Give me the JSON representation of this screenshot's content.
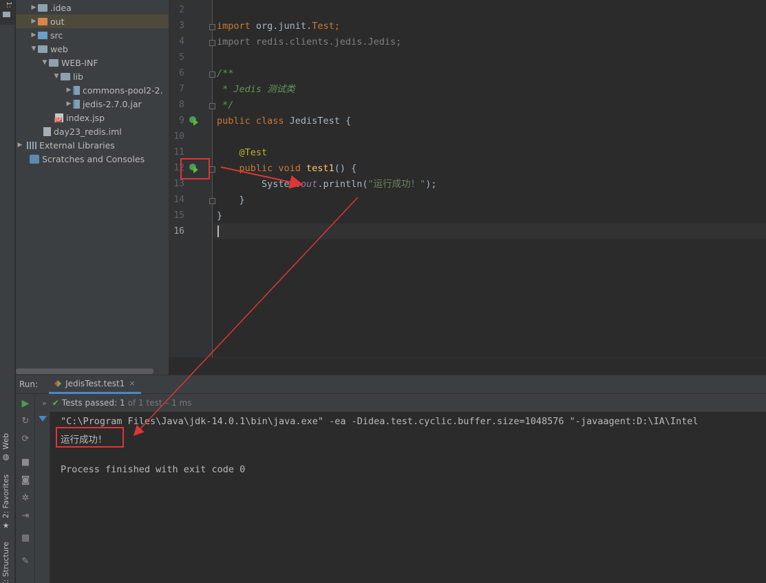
{
  "left_strip": {
    "project_tab": "1:",
    "web_tab": "Web",
    "favorites_tab": "2: Favorites",
    "structure_tab": "Z: Structure"
  },
  "project_tree": [
    {
      "label": ".idea",
      "icon": "folder-icon",
      "expanded": false
    },
    {
      "label": "out",
      "icon": "folder-orange-icon",
      "expanded": false
    },
    {
      "label": "src",
      "icon": "folder-blue-icon",
      "expanded": false
    },
    {
      "label": "web",
      "icon": "folder-web-icon",
      "expanded": true
    },
    {
      "label": "WEB-INF",
      "icon": "folder-icon",
      "expanded": true
    },
    {
      "label": "lib",
      "icon": "folder-icon",
      "expanded": true
    },
    {
      "label": "commons-pool2-2.",
      "icon": "jar-icon",
      "expanded": false
    },
    {
      "label": "jedis-2.7.0.jar",
      "icon": "jar-icon",
      "expanded": false
    },
    {
      "label": "index.jsp",
      "icon": "jsp-file-icon"
    },
    {
      "label": "day23_redis.iml",
      "icon": "iml-file-icon"
    },
    {
      "label": "External Libraries",
      "icon": "libraries-icon",
      "expanded": false
    },
    {
      "label": "Scratches and Consoles",
      "icon": "scratches-icon"
    }
  ],
  "editor": {
    "line_numbers": [
      "2",
      "3",
      "4",
      "5",
      "6",
      "7",
      "8",
      "9",
      "10",
      "11",
      "12",
      "13",
      "14",
      "15",
      "16"
    ],
    "lines": {
      "l3": {
        "kw": "import",
        "pkg": " org.junit.",
        "cls": "Test",
        "semi": ";"
      },
      "l4": {
        "text": "import redis.clients.jedis.Jedis;"
      },
      "l6": {
        "text": "/**"
      },
      "l7": {
        "text": " * Jedis 测试类"
      },
      "l8": {
        "text": " */"
      },
      "l9": {
        "kw": "public class ",
        "name": "JedisTest",
        "rest": " {"
      },
      "l11": {
        "text": "    @Test"
      },
      "l12": {
        "kw": "    public void ",
        "name": "test1",
        "rest": "() {"
      },
      "l13": {
        "a": "        System.",
        "fld": "out",
        "b": ".println(",
        "str": "\"运行成功！\"",
        "c": ");"
      },
      "l14": {
        "text": "    }"
      },
      "l15": {
        "text": "}"
      }
    }
  },
  "run_panel": {
    "label": "Run:",
    "tab_title": "JedisTest.test1",
    "tab_close": "×",
    "status_prefix": "»",
    "tests_passed": "Tests passed:",
    "passed_count": "1",
    "passed_rest": "of 1 test – 1 ms",
    "console_lines": [
      "\"C:\\Program Files\\Java\\jdk-14.0.1\\bin\\java.exe\" -ea -Didea.test.cyclic.buffer.size=1048576 \"-javaagent:D:\\IA\\Intel",
      "运行成功！",
      "",
      "Process finished with exit code 0"
    ]
  },
  "colors": {
    "annotation_red": "#e03535",
    "run_green": "#499c54",
    "keyword_orange": "#cc7832"
  }
}
